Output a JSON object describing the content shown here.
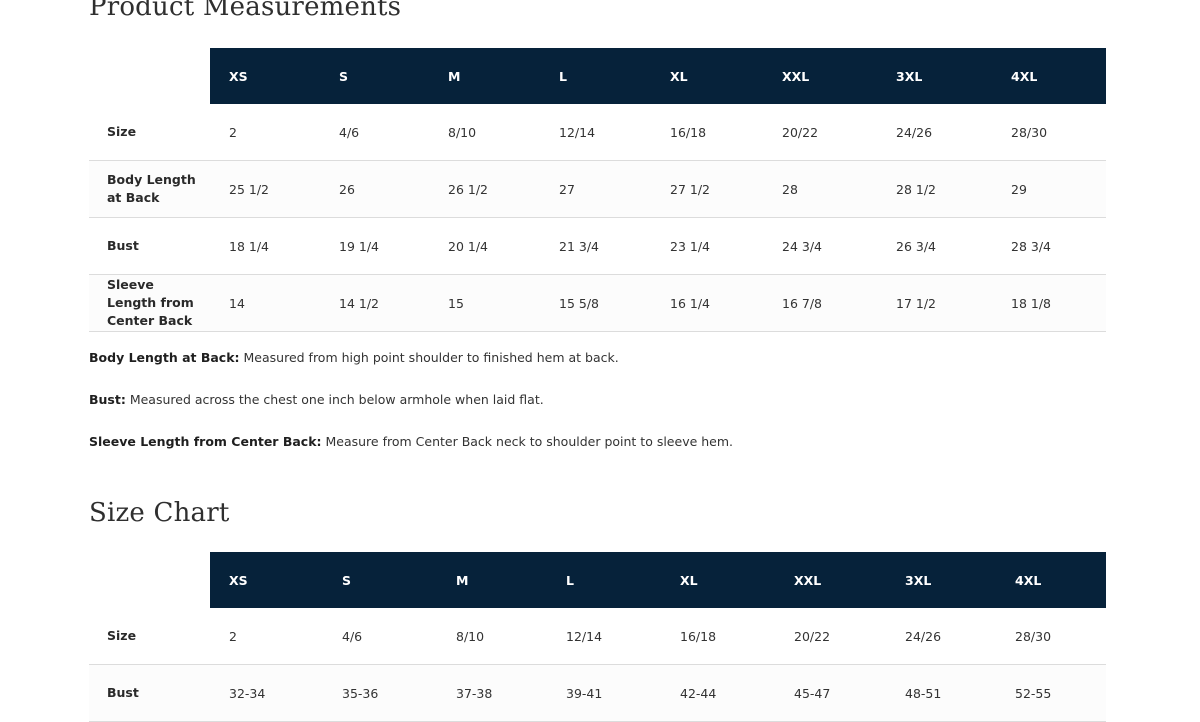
{
  "measurements": {
    "title": "Product Measurements",
    "sizes": [
      "XS",
      "S",
      "M",
      "L",
      "XL",
      "XXL",
      "3XL",
      "4XL"
    ],
    "rows": [
      {
        "label": "Size",
        "values": [
          "2",
          "4/6",
          "8/10",
          "12/14",
          "16/18",
          "20/22",
          "24/26",
          "28/30"
        ]
      },
      {
        "label": "Body Length at Back",
        "values": [
          "25 1/2",
          "26",
          "26 1/2",
          "27",
          "27 1/2",
          "28",
          "28 1/2",
          "29"
        ]
      },
      {
        "label": "Bust",
        "values": [
          "18 1/4",
          "19 1/4",
          "20 1/4",
          "21 3/4",
          "23 1/4",
          "24 3/4",
          "26 3/4",
          "28 3/4"
        ]
      },
      {
        "label": "Sleeve Length from Center Back",
        "values": [
          "14",
          "14 1/2",
          "15",
          "15 5/8",
          "16 1/4",
          "16 7/8",
          "17 1/2",
          "18 1/8"
        ]
      }
    ],
    "notes": [
      {
        "term": "Body Length at Back:",
        "text": " Measured from high point shoulder to finished hem at back."
      },
      {
        "term": "Bust:",
        "text": " Measured across the chest one inch below armhole when laid flat."
      },
      {
        "term": "Sleeve Length from Center Back:",
        "text": " Measure from Center Back neck to shoulder point to sleeve hem."
      }
    ]
  },
  "size_chart": {
    "title": "Size Chart",
    "sizes": [
      "XS",
      "S",
      "M",
      "L",
      "XL",
      "XXL",
      "3XL",
      "4XL"
    ],
    "rows": [
      {
        "label": "Size",
        "values": [
          "2",
          "4/6",
          "8/10",
          "12/14",
          "16/18",
          "20/22",
          "24/26",
          "28/30"
        ]
      },
      {
        "label": "Bust",
        "values": [
          "32-34",
          "35-36",
          "37-38",
          "39-41",
          "42-44",
          "45-47",
          "48-51",
          "52-55"
        ]
      }
    ]
  }
}
